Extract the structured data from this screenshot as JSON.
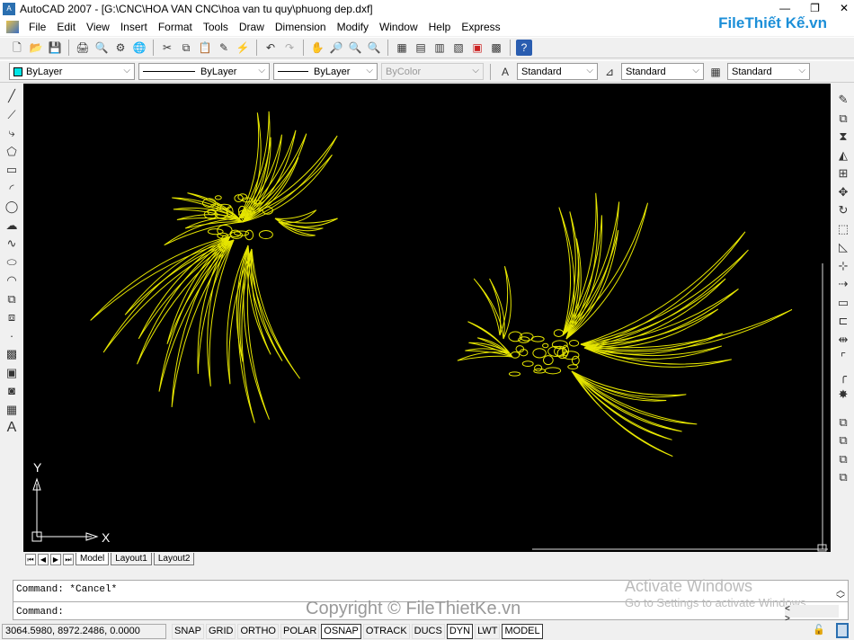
{
  "title": "AutoCAD 2007 - [G:\\CNC\\HOA VAN CNC\\hoa van tu quy\\phuong dep.dxf]",
  "menu": [
    "File",
    "Edit",
    "View",
    "Insert",
    "Format",
    "Tools",
    "Draw",
    "Dimension",
    "Modify",
    "Window",
    "Help",
    "Express"
  ],
  "logo": "FileThiết Kế.vn",
  "properties": {
    "layer": "ByLayer",
    "linetype": "ByLayer",
    "lineweight": "ByLayer",
    "plotstyle": "ByColor",
    "text_style": "Standard",
    "dim_style": "Standard",
    "table_style": "Standard",
    "layer_color": "#00e5e5"
  },
  "tabs": [
    "Model",
    "Layout1",
    "Layout2"
  ],
  "ucs": {
    "x": "X",
    "y": "Y"
  },
  "command": {
    "history": "Command: *Cancel*",
    "prompt": "Command:"
  },
  "watermarks": {
    "activate_title": "Activate Windows",
    "activate_sub": "Go to Settings to activate Windows.",
    "copyright": "Copyright © FileThietKe.vn"
  },
  "status": {
    "coords": "3064.5980, 8972.2486, 0.0000",
    "buttons": [
      {
        "label": "SNAP",
        "on": false
      },
      {
        "label": "GRID",
        "on": false
      },
      {
        "label": "ORTHO",
        "on": false
      },
      {
        "label": "POLAR",
        "on": false
      },
      {
        "label": "OSNAP",
        "on": true
      },
      {
        "label": "OTRACK",
        "on": false
      },
      {
        "label": "DUCS",
        "on": false
      },
      {
        "label": "DYN",
        "on": true
      },
      {
        "label": "LWT",
        "on": false
      },
      {
        "label": "MODEL",
        "on": true
      }
    ]
  },
  "drawing_color": "#e6e600"
}
